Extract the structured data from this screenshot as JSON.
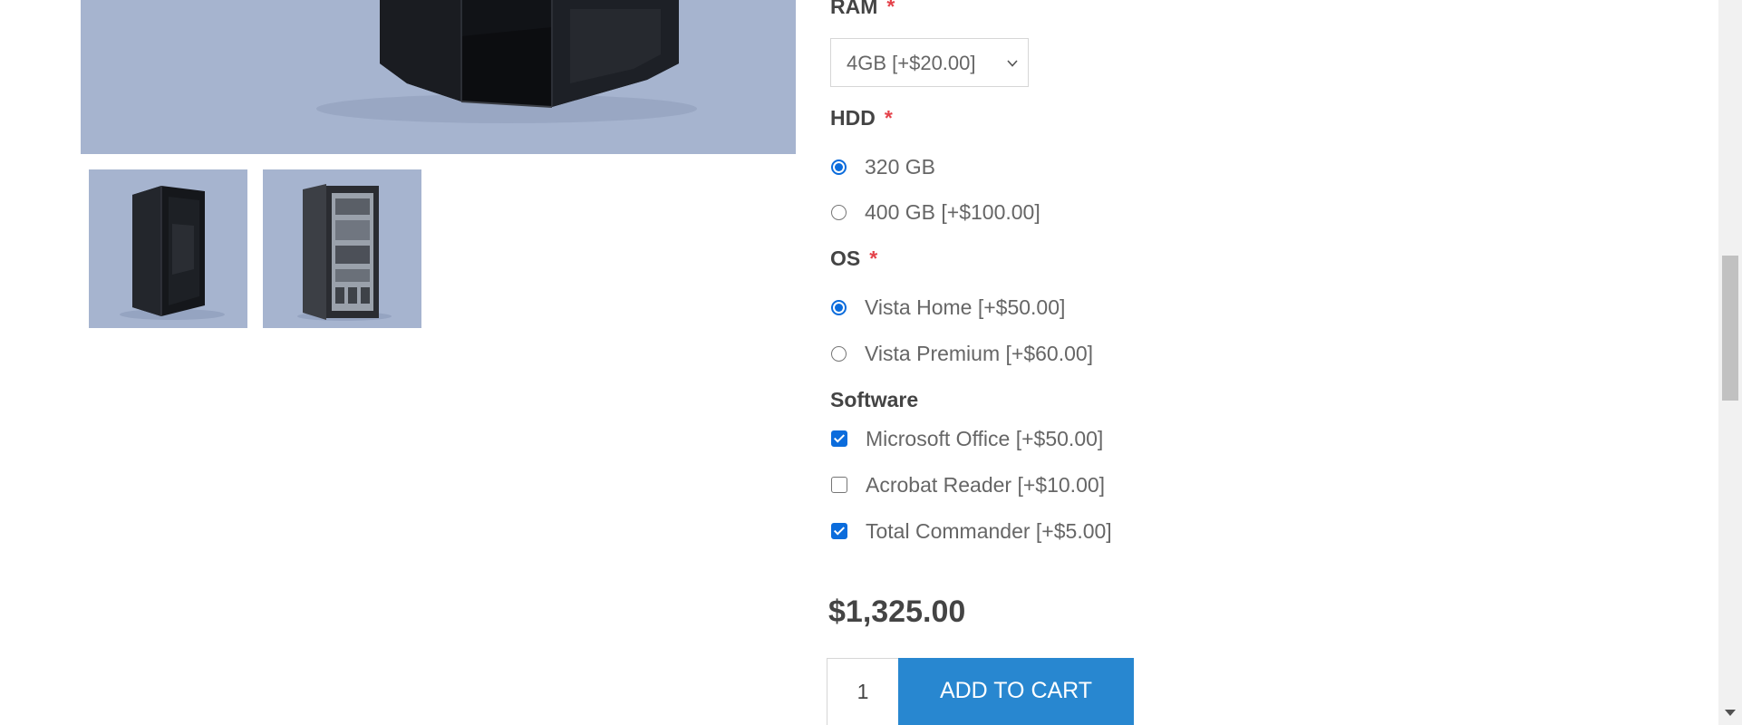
{
  "product_images": {
    "main_alt": "Product image",
    "thumbnails": [
      "thumbnail 1",
      "thumbnail 2"
    ]
  },
  "options": {
    "ram": {
      "title": "RAM",
      "required_mark": "*",
      "selected": "4GB [+$20.00]"
    },
    "hdd": {
      "title": "HDD",
      "required_mark": "*",
      "choices": [
        {
          "label": "320 GB",
          "checked": true
        },
        {
          "label": "400 GB [+$100.00]",
          "checked": false
        }
      ]
    },
    "os": {
      "title": "OS",
      "required_mark": "*",
      "choices": [
        {
          "label": "Vista Home [+$50.00]",
          "checked": true
        },
        {
          "label": "Vista Premium [+$60.00]",
          "checked": false
        }
      ]
    },
    "software": {
      "title": "Software",
      "choices": [
        {
          "label": "Microsoft Office [+$50.00]",
          "checked": true
        },
        {
          "label": "Acrobat Reader [+$10.00]",
          "checked": false
        },
        {
          "label": "Total Commander [+$5.00]",
          "checked": true
        }
      ]
    }
  },
  "purchase": {
    "price": "$1,325.00",
    "quantity": "1",
    "add_to_cart_label": "ADD TO CART"
  },
  "colors": {
    "accent": "#2887d0",
    "control_checked": "#0b6cdc",
    "required": "#e4434b",
    "image_background": "#a6b4cf"
  },
  "scrollbar": {
    "position_fraction": 0.43
  }
}
